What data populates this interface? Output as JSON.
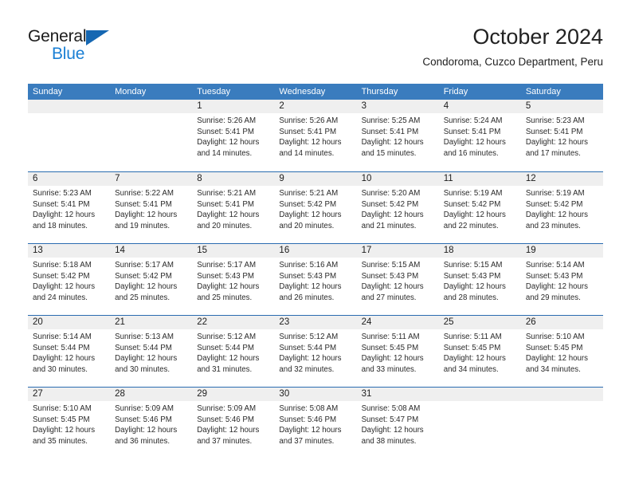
{
  "brand": {
    "name_part1": "General",
    "name_part2": "Blue",
    "accent_color": "#1a7fd4",
    "triangle_color": "#1567b2",
    "triangle_icon": "triangle-icon"
  },
  "header": {
    "title": "October 2024",
    "subtitle": "Condoroma, Cuzco Department, Peru"
  },
  "calendar": {
    "header_bg": "#3a7cbe",
    "header_text_color": "#ffffff",
    "row_divider_color": "#2a6cb0",
    "date_band_color": "#efefef",
    "weekdays": [
      "Sunday",
      "Monday",
      "Tuesday",
      "Wednesday",
      "Thursday",
      "Friday",
      "Saturday"
    ],
    "weeks": [
      [
        {
          "day": "",
          "lines": []
        },
        {
          "day": "",
          "lines": []
        },
        {
          "day": "1",
          "lines": [
            "Sunrise: 5:26 AM",
            "Sunset: 5:41 PM",
            "Daylight: 12 hours",
            "and 14 minutes."
          ]
        },
        {
          "day": "2",
          "lines": [
            "Sunrise: 5:26 AM",
            "Sunset: 5:41 PM",
            "Daylight: 12 hours",
            "and 14 minutes."
          ]
        },
        {
          "day": "3",
          "lines": [
            "Sunrise: 5:25 AM",
            "Sunset: 5:41 PM",
            "Daylight: 12 hours",
            "and 15 minutes."
          ]
        },
        {
          "day": "4",
          "lines": [
            "Sunrise: 5:24 AM",
            "Sunset: 5:41 PM",
            "Daylight: 12 hours",
            "and 16 minutes."
          ]
        },
        {
          "day": "5",
          "lines": [
            "Sunrise: 5:23 AM",
            "Sunset: 5:41 PM",
            "Daylight: 12 hours",
            "and 17 minutes."
          ]
        }
      ],
      [
        {
          "day": "6",
          "lines": [
            "Sunrise: 5:23 AM",
            "Sunset: 5:41 PM",
            "Daylight: 12 hours",
            "and 18 minutes."
          ]
        },
        {
          "day": "7",
          "lines": [
            "Sunrise: 5:22 AM",
            "Sunset: 5:41 PM",
            "Daylight: 12 hours",
            "and 19 minutes."
          ]
        },
        {
          "day": "8",
          "lines": [
            "Sunrise: 5:21 AM",
            "Sunset: 5:41 PM",
            "Daylight: 12 hours",
            "and 20 minutes."
          ]
        },
        {
          "day": "9",
          "lines": [
            "Sunrise: 5:21 AM",
            "Sunset: 5:42 PM",
            "Daylight: 12 hours",
            "and 20 minutes."
          ]
        },
        {
          "day": "10",
          "lines": [
            "Sunrise: 5:20 AM",
            "Sunset: 5:42 PM",
            "Daylight: 12 hours",
            "and 21 minutes."
          ]
        },
        {
          "day": "11",
          "lines": [
            "Sunrise: 5:19 AM",
            "Sunset: 5:42 PM",
            "Daylight: 12 hours",
            "and 22 minutes."
          ]
        },
        {
          "day": "12",
          "lines": [
            "Sunrise: 5:19 AM",
            "Sunset: 5:42 PM",
            "Daylight: 12 hours",
            "and 23 minutes."
          ]
        }
      ],
      [
        {
          "day": "13",
          "lines": [
            "Sunrise: 5:18 AM",
            "Sunset: 5:42 PM",
            "Daylight: 12 hours",
            "and 24 minutes."
          ]
        },
        {
          "day": "14",
          "lines": [
            "Sunrise: 5:17 AM",
            "Sunset: 5:42 PM",
            "Daylight: 12 hours",
            "and 25 minutes."
          ]
        },
        {
          "day": "15",
          "lines": [
            "Sunrise: 5:17 AM",
            "Sunset: 5:43 PM",
            "Daylight: 12 hours",
            "and 25 minutes."
          ]
        },
        {
          "day": "16",
          "lines": [
            "Sunrise: 5:16 AM",
            "Sunset: 5:43 PM",
            "Daylight: 12 hours",
            "and 26 minutes."
          ]
        },
        {
          "day": "17",
          "lines": [
            "Sunrise: 5:15 AM",
            "Sunset: 5:43 PM",
            "Daylight: 12 hours",
            "and 27 minutes."
          ]
        },
        {
          "day": "18",
          "lines": [
            "Sunrise: 5:15 AM",
            "Sunset: 5:43 PM",
            "Daylight: 12 hours",
            "and 28 minutes."
          ]
        },
        {
          "day": "19",
          "lines": [
            "Sunrise: 5:14 AM",
            "Sunset: 5:43 PM",
            "Daylight: 12 hours",
            "and 29 minutes."
          ]
        }
      ],
      [
        {
          "day": "20",
          "lines": [
            "Sunrise: 5:14 AM",
            "Sunset: 5:44 PM",
            "Daylight: 12 hours",
            "and 30 minutes."
          ]
        },
        {
          "day": "21",
          "lines": [
            "Sunrise: 5:13 AM",
            "Sunset: 5:44 PM",
            "Daylight: 12 hours",
            "and 30 minutes."
          ]
        },
        {
          "day": "22",
          "lines": [
            "Sunrise: 5:12 AM",
            "Sunset: 5:44 PM",
            "Daylight: 12 hours",
            "and 31 minutes."
          ]
        },
        {
          "day": "23",
          "lines": [
            "Sunrise: 5:12 AM",
            "Sunset: 5:44 PM",
            "Daylight: 12 hours",
            "and 32 minutes."
          ]
        },
        {
          "day": "24",
          "lines": [
            "Sunrise: 5:11 AM",
            "Sunset: 5:45 PM",
            "Daylight: 12 hours",
            "and 33 minutes."
          ]
        },
        {
          "day": "25",
          "lines": [
            "Sunrise: 5:11 AM",
            "Sunset: 5:45 PM",
            "Daylight: 12 hours",
            "and 34 minutes."
          ]
        },
        {
          "day": "26",
          "lines": [
            "Sunrise: 5:10 AM",
            "Sunset: 5:45 PM",
            "Daylight: 12 hours",
            "and 34 minutes."
          ]
        }
      ],
      [
        {
          "day": "27",
          "lines": [
            "Sunrise: 5:10 AM",
            "Sunset: 5:45 PM",
            "Daylight: 12 hours",
            "and 35 minutes."
          ]
        },
        {
          "day": "28",
          "lines": [
            "Sunrise: 5:09 AM",
            "Sunset: 5:46 PM",
            "Daylight: 12 hours",
            "and 36 minutes."
          ]
        },
        {
          "day": "29",
          "lines": [
            "Sunrise: 5:09 AM",
            "Sunset: 5:46 PM",
            "Daylight: 12 hours",
            "and 37 minutes."
          ]
        },
        {
          "day": "30",
          "lines": [
            "Sunrise: 5:08 AM",
            "Sunset: 5:46 PM",
            "Daylight: 12 hours",
            "and 37 minutes."
          ]
        },
        {
          "day": "31",
          "lines": [
            "Sunrise: 5:08 AM",
            "Sunset: 5:47 PM",
            "Daylight: 12 hours",
            "and 38 minutes."
          ]
        },
        {
          "day": "",
          "lines": []
        },
        {
          "day": "",
          "lines": []
        }
      ]
    ]
  }
}
